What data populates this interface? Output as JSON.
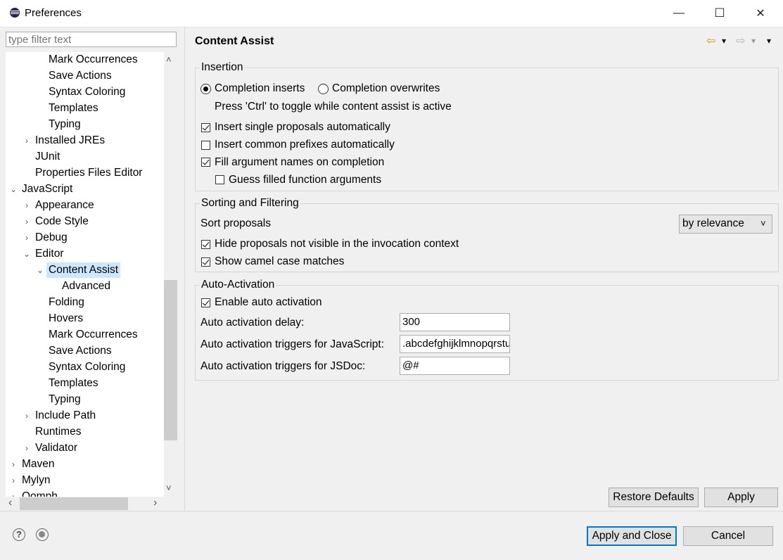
{
  "window": {
    "title": "Preferences",
    "minimize": "—",
    "maximize": "☐",
    "close": "✕"
  },
  "filter": {
    "placeholder": "type filter text"
  },
  "tree": [
    {
      "label": "Mark Occurrences",
      "level": 3,
      "tw": ""
    },
    {
      "label": "Save Actions",
      "level": 3,
      "tw": ""
    },
    {
      "label": "Syntax Coloring",
      "level": 3,
      "tw": ""
    },
    {
      "label": "Templates",
      "level": 3,
      "tw": ""
    },
    {
      "label": "Typing",
      "level": 3,
      "tw": ""
    },
    {
      "label": "Installed JREs",
      "level": 2,
      "tw": "›"
    },
    {
      "label": "JUnit",
      "level": 2,
      "tw": ""
    },
    {
      "label": "Properties Files Editor",
      "level": 2,
      "tw": ""
    },
    {
      "label": "JavaScript",
      "level": 1,
      "tw": "⌄"
    },
    {
      "label": "Appearance",
      "level": 2,
      "tw": "›"
    },
    {
      "label": "Code Style",
      "level": 2,
      "tw": "›"
    },
    {
      "label": "Debug",
      "level": 2,
      "tw": "›"
    },
    {
      "label": "Editor",
      "level": 2,
      "tw": "⌄"
    },
    {
      "label": "Content Assist",
      "level": 3,
      "tw": "⌄",
      "selected": true
    },
    {
      "label": "Advanced",
      "level": 4,
      "tw": ""
    },
    {
      "label": "Folding",
      "level": 3,
      "tw": ""
    },
    {
      "label": "Hovers",
      "level": 3,
      "tw": ""
    },
    {
      "label": "Mark Occurrences",
      "level": 3,
      "tw": ""
    },
    {
      "label": "Save Actions",
      "level": 3,
      "tw": ""
    },
    {
      "label": "Syntax Coloring",
      "level": 3,
      "tw": ""
    },
    {
      "label": "Templates",
      "level": 3,
      "tw": ""
    },
    {
      "label": "Typing",
      "level": 3,
      "tw": ""
    },
    {
      "label": "Include Path",
      "level": 2,
      "tw": "›"
    },
    {
      "label": "Runtimes",
      "level": 2,
      "tw": ""
    },
    {
      "label": "Validator",
      "level": 2,
      "tw": "›"
    },
    {
      "label": "Maven",
      "level": 1,
      "tw": "›"
    },
    {
      "label": "Mylyn",
      "level": 1,
      "tw": "›"
    },
    {
      "label": "Oomph",
      "level": 1,
      "tw": "›"
    }
  ],
  "page": {
    "title": "Content Assist"
  },
  "insertion": {
    "title": "Insertion",
    "radio_inserts": "Completion inserts",
    "radio_overwrites": "Completion overwrites",
    "selected": "inserts",
    "hint": "Press 'Ctrl' to toggle while content assist is active",
    "checks": [
      {
        "label": "Insert single proposals automatically",
        "checked": true
      },
      {
        "label": "Insert common prefixes automatically",
        "checked": false
      },
      {
        "label": "Fill argument names on completion",
        "checked": true
      },
      {
        "label": "Guess filled function arguments",
        "checked": false
      }
    ]
  },
  "sorting": {
    "title": "Sorting and Filtering",
    "sort_label": "Sort proposals",
    "sort_value": "by relevance",
    "checks": [
      {
        "label": "Hide proposals not visible in the invocation context",
        "checked": true
      },
      {
        "label": "Show camel case matches",
        "checked": true
      }
    ]
  },
  "auto": {
    "title": "Auto-Activation",
    "enable": {
      "label": "Enable auto activation",
      "checked": true
    },
    "delay_label": "Auto activation delay:",
    "delay_value": "300",
    "js_label": "Auto activation triggers for JavaScript:",
    "js_value": ".abcdefghijklmnopqrstuvwxyz",
    "jsdoc_label": "Auto activation triggers for JSDoc:",
    "jsdoc_value": "@#"
  },
  "buttons": {
    "restore": "Restore Defaults",
    "apply": "Apply",
    "apply_close": "Apply and Close",
    "cancel": "Cancel"
  },
  "icons": {
    "help": "?",
    "back": "⇦",
    "forward": "⇨",
    "dropdown": "▾",
    "up": "˄",
    "down": "˅",
    "left": "‹",
    "right": "›"
  }
}
